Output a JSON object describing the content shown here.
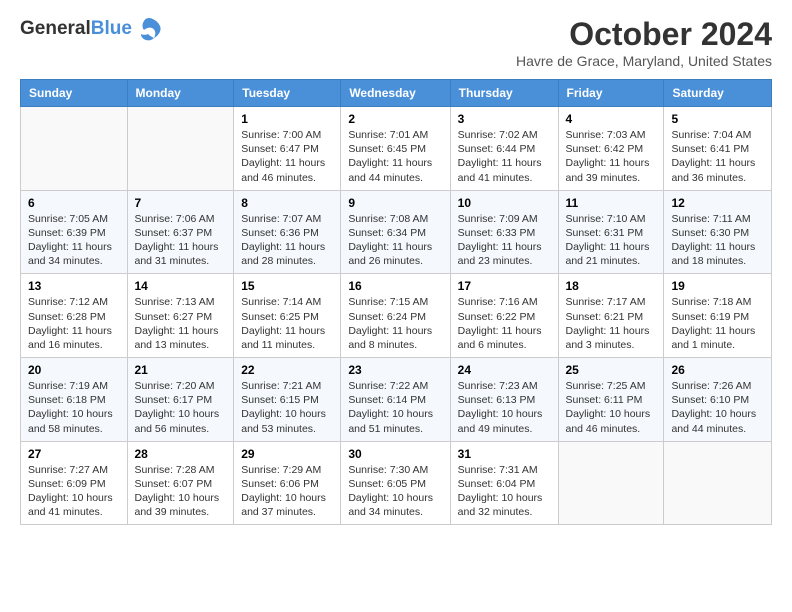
{
  "header": {
    "logo_line1": "General",
    "logo_line2": "Blue",
    "month_title": "October 2024",
    "location": "Havre de Grace, Maryland, United States"
  },
  "weekdays": [
    "Sunday",
    "Monday",
    "Tuesday",
    "Wednesday",
    "Thursday",
    "Friday",
    "Saturday"
  ],
  "weeks": [
    [
      {
        "day": "",
        "sunrise": "",
        "sunset": "",
        "daylight": ""
      },
      {
        "day": "",
        "sunrise": "",
        "sunset": "",
        "daylight": ""
      },
      {
        "day": "1",
        "sunrise": "Sunrise: 7:00 AM",
        "sunset": "Sunset: 6:47 PM",
        "daylight": "Daylight: 11 hours and 46 minutes."
      },
      {
        "day": "2",
        "sunrise": "Sunrise: 7:01 AM",
        "sunset": "Sunset: 6:45 PM",
        "daylight": "Daylight: 11 hours and 44 minutes."
      },
      {
        "day": "3",
        "sunrise": "Sunrise: 7:02 AM",
        "sunset": "Sunset: 6:44 PM",
        "daylight": "Daylight: 11 hours and 41 minutes."
      },
      {
        "day": "4",
        "sunrise": "Sunrise: 7:03 AM",
        "sunset": "Sunset: 6:42 PM",
        "daylight": "Daylight: 11 hours and 39 minutes."
      },
      {
        "day": "5",
        "sunrise": "Sunrise: 7:04 AM",
        "sunset": "Sunset: 6:41 PM",
        "daylight": "Daylight: 11 hours and 36 minutes."
      }
    ],
    [
      {
        "day": "6",
        "sunrise": "Sunrise: 7:05 AM",
        "sunset": "Sunset: 6:39 PM",
        "daylight": "Daylight: 11 hours and 34 minutes."
      },
      {
        "day": "7",
        "sunrise": "Sunrise: 7:06 AM",
        "sunset": "Sunset: 6:37 PM",
        "daylight": "Daylight: 11 hours and 31 minutes."
      },
      {
        "day": "8",
        "sunrise": "Sunrise: 7:07 AM",
        "sunset": "Sunset: 6:36 PM",
        "daylight": "Daylight: 11 hours and 28 minutes."
      },
      {
        "day": "9",
        "sunrise": "Sunrise: 7:08 AM",
        "sunset": "Sunset: 6:34 PM",
        "daylight": "Daylight: 11 hours and 26 minutes."
      },
      {
        "day": "10",
        "sunrise": "Sunrise: 7:09 AM",
        "sunset": "Sunset: 6:33 PM",
        "daylight": "Daylight: 11 hours and 23 minutes."
      },
      {
        "day": "11",
        "sunrise": "Sunrise: 7:10 AM",
        "sunset": "Sunset: 6:31 PM",
        "daylight": "Daylight: 11 hours and 21 minutes."
      },
      {
        "day": "12",
        "sunrise": "Sunrise: 7:11 AM",
        "sunset": "Sunset: 6:30 PM",
        "daylight": "Daylight: 11 hours and 18 minutes."
      }
    ],
    [
      {
        "day": "13",
        "sunrise": "Sunrise: 7:12 AM",
        "sunset": "Sunset: 6:28 PM",
        "daylight": "Daylight: 11 hours and 16 minutes."
      },
      {
        "day": "14",
        "sunrise": "Sunrise: 7:13 AM",
        "sunset": "Sunset: 6:27 PM",
        "daylight": "Daylight: 11 hours and 13 minutes."
      },
      {
        "day": "15",
        "sunrise": "Sunrise: 7:14 AM",
        "sunset": "Sunset: 6:25 PM",
        "daylight": "Daylight: 11 hours and 11 minutes."
      },
      {
        "day": "16",
        "sunrise": "Sunrise: 7:15 AM",
        "sunset": "Sunset: 6:24 PM",
        "daylight": "Daylight: 11 hours and 8 minutes."
      },
      {
        "day": "17",
        "sunrise": "Sunrise: 7:16 AM",
        "sunset": "Sunset: 6:22 PM",
        "daylight": "Daylight: 11 hours and 6 minutes."
      },
      {
        "day": "18",
        "sunrise": "Sunrise: 7:17 AM",
        "sunset": "Sunset: 6:21 PM",
        "daylight": "Daylight: 11 hours and 3 minutes."
      },
      {
        "day": "19",
        "sunrise": "Sunrise: 7:18 AM",
        "sunset": "Sunset: 6:19 PM",
        "daylight": "Daylight: 11 hours and 1 minute."
      }
    ],
    [
      {
        "day": "20",
        "sunrise": "Sunrise: 7:19 AM",
        "sunset": "Sunset: 6:18 PM",
        "daylight": "Daylight: 10 hours and 58 minutes."
      },
      {
        "day": "21",
        "sunrise": "Sunrise: 7:20 AM",
        "sunset": "Sunset: 6:17 PM",
        "daylight": "Daylight: 10 hours and 56 minutes."
      },
      {
        "day": "22",
        "sunrise": "Sunrise: 7:21 AM",
        "sunset": "Sunset: 6:15 PM",
        "daylight": "Daylight: 10 hours and 53 minutes."
      },
      {
        "day": "23",
        "sunrise": "Sunrise: 7:22 AM",
        "sunset": "Sunset: 6:14 PM",
        "daylight": "Daylight: 10 hours and 51 minutes."
      },
      {
        "day": "24",
        "sunrise": "Sunrise: 7:23 AM",
        "sunset": "Sunset: 6:13 PM",
        "daylight": "Daylight: 10 hours and 49 minutes."
      },
      {
        "day": "25",
        "sunrise": "Sunrise: 7:25 AM",
        "sunset": "Sunset: 6:11 PM",
        "daylight": "Daylight: 10 hours and 46 minutes."
      },
      {
        "day": "26",
        "sunrise": "Sunrise: 7:26 AM",
        "sunset": "Sunset: 6:10 PM",
        "daylight": "Daylight: 10 hours and 44 minutes."
      }
    ],
    [
      {
        "day": "27",
        "sunrise": "Sunrise: 7:27 AM",
        "sunset": "Sunset: 6:09 PM",
        "daylight": "Daylight: 10 hours and 41 minutes."
      },
      {
        "day": "28",
        "sunrise": "Sunrise: 7:28 AM",
        "sunset": "Sunset: 6:07 PM",
        "daylight": "Daylight: 10 hours and 39 minutes."
      },
      {
        "day": "29",
        "sunrise": "Sunrise: 7:29 AM",
        "sunset": "Sunset: 6:06 PM",
        "daylight": "Daylight: 10 hours and 37 minutes."
      },
      {
        "day": "30",
        "sunrise": "Sunrise: 7:30 AM",
        "sunset": "Sunset: 6:05 PM",
        "daylight": "Daylight: 10 hours and 34 minutes."
      },
      {
        "day": "31",
        "sunrise": "Sunrise: 7:31 AM",
        "sunset": "Sunset: 6:04 PM",
        "daylight": "Daylight: 10 hours and 32 minutes."
      },
      {
        "day": "",
        "sunrise": "",
        "sunset": "",
        "daylight": ""
      },
      {
        "day": "",
        "sunrise": "",
        "sunset": "",
        "daylight": ""
      }
    ]
  ]
}
